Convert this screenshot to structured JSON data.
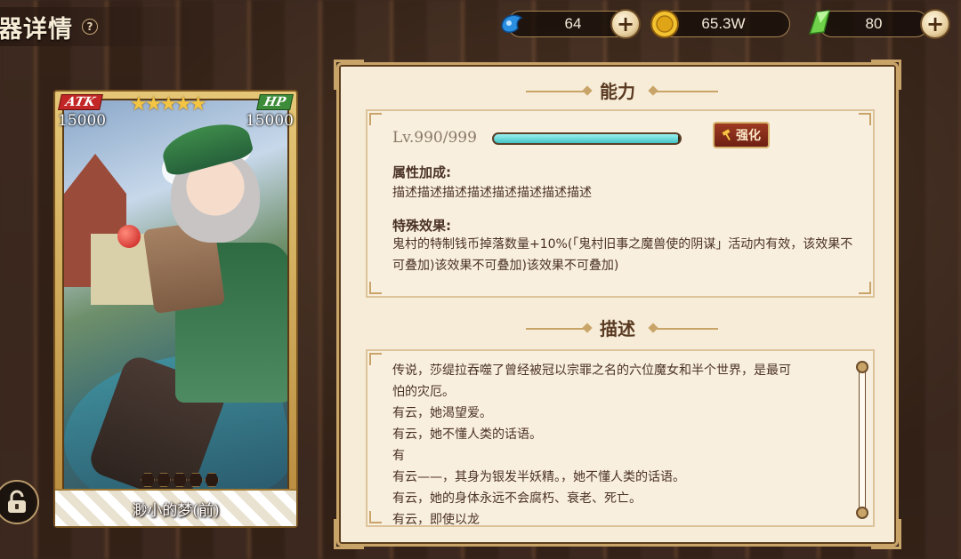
{
  "header": {
    "title": "器详情",
    "help_icon": "question-icon"
  },
  "currencies": [
    {
      "name": "blue-gem",
      "icon": "blue-gem-icon",
      "value": "64"
    },
    {
      "name": "gold-coin",
      "icon": "gold-coin-icon",
      "value": "65.3W"
    },
    {
      "name": "green-crystal",
      "icon": "green-crystal-icon",
      "value": "80"
    }
  ],
  "card": {
    "atk_label": "ATK",
    "atk_value": "15000",
    "hp_label": "HP",
    "hp_value": "15000",
    "stars": "★★★★★",
    "star_count": 5,
    "gem_slots": 5,
    "name": "渺小的梦(前)"
  },
  "ability": {
    "section_title": "能力",
    "level": "Lv.990/999",
    "level_progress": 0.99,
    "enhance_label": "强化",
    "attr_title": "属性加成:",
    "attr_text": "描述描述描述描述描述描述描述描述",
    "special_title": "特殊效果:",
    "special_text": "鬼村的特制钱币掉落数量+10%(「鬼村旧事之魔兽使的阴谋」活动内有效，该效果不可叠加)该效果不可叠加)该效果不可叠加)"
  },
  "description": {
    "section_title": "描述",
    "lines": [
      "传说，莎缇拉吞噬了曾经被冠以宗罪之名的六位魔女和半个世界，是最可",
      "怕的灾厄。",
      "有云，她渴望爱。",
      "有云，她不懂人类的话语。",
      "有",
      "有云——，其身为银发半妖精。，她不懂人类的话语。",
      "有云，她的身体永远不会腐朽、衰老、死亡。",
      "有云，即使以龙"
    ]
  },
  "colors": {
    "panel_bg": "#f7ecd7",
    "gold_border": "#c9a469",
    "text_brown": "#4a3226",
    "enhance_red": "#8a2e1a",
    "exp_cyan": "#45c3c6"
  }
}
